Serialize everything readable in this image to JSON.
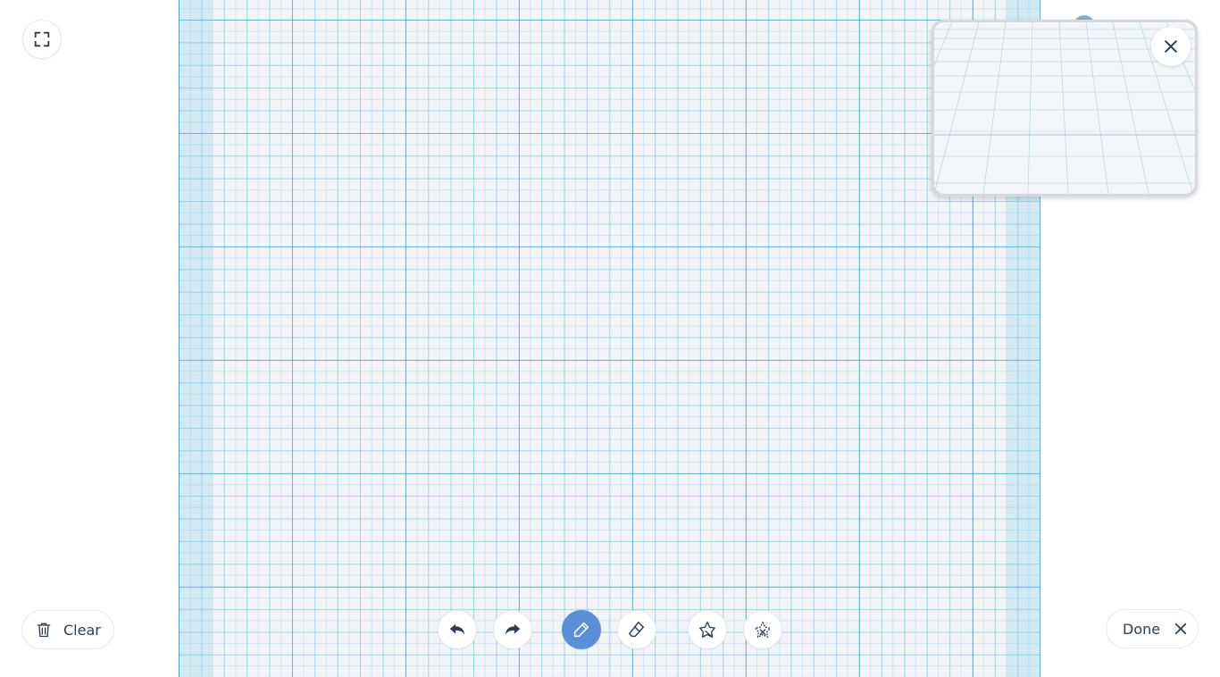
{
  "actions": {
    "clear_label": "Clear",
    "done_label": "Done"
  },
  "toolbar": {
    "tools": [
      {
        "name": "undo",
        "icon": "undo-icon"
      },
      {
        "name": "redo",
        "icon": "redo-icon"
      },
      {
        "name": "pencil",
        "icon": "pencil-icon",
        "active": true
      },
      {
        "name": "eraser",
        "icon": "eraser-icon"
      },
      {
        "name": "shape",
        "icon": "shape-icon"
      },
      {
        "name": "shape-eraser",
        "icon": "shape-eraser-icon"
      }
    ]
  },
  "colors": {
    "accent": "#5b8fd8",
    "icon": "#2d3e50",
    "paper": "#f3f4f7",
    "grid": "#4696be"
  }
}
